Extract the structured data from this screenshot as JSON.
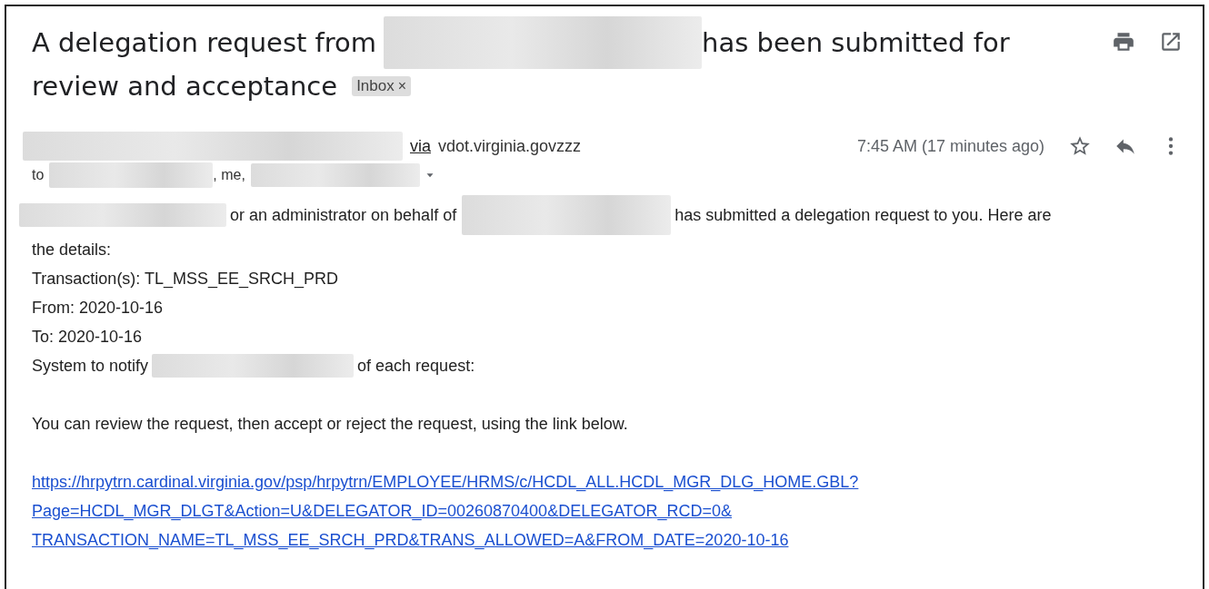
{
  "subject": {
    "parts": [
      "A delegation request from",
      "has been submitted for",
      "review and acceptance"
    ],
    "label": {
      "text": "Inbox",
      "close": "×"
    }
  },
  "message": {
    "via": "via",
    "domain": "vdot.virginia.govzzz",
    "time": "7:45 AM (17 minutes ago)",
    "starred": false,
    "to_label": "to",
    "recipients_sep": ", me,"
  },
  "body": {
    "intro_parts": [
      "or an administrator on behalf of",
      "has submitted a delegation request to you.  Here are",
      "the details:"
    ],
    "details": [
      "Transaction(s):  TL_MSS_EE_SRCH_PRD",
      "From: 2020-10-16",
      "To: 2020-10-16"
    ],
    "notify_parts": [
      "System to notify",
      "of each request:"
    ],
    "instruction": "You can review the request, then accept or reject the request, using the link below.",
    "link_lines": [
      "https://hrpytrn.cardinal.virginia.gov/psp/hrpytrn/EMPLOYEE/HRMS/c/HCDL_ALL.HCDL_MGR_DLG_HOME.GBL?",
      "Page=HCDL_MGR_DLGT&Action=U&DELEGATOR_ID=00260870400&DELEGATOR_RCD=0&",
      "TRANSACTION_NAME=TL_MSS_EE_SRCH_PRD&TRANS_ALLOWED=A&FROM_DATE=2020-10-16"
    ]
  }
}
